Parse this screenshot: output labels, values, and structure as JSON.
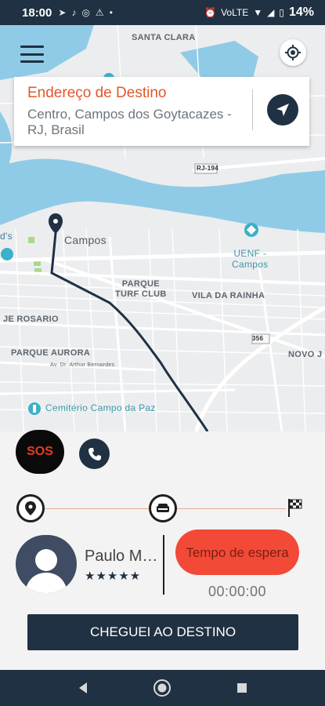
{
  "status_bar": {
    "time": "18:00",
    "battery": "14%",
    "network": "VoLTE"
  },
  "map": {
    "labels": {
      "santa_clara": "SANTA CLARA",
      "rj194": "RJ-194",
      "campos": "Campos",
      "uenf": "UENF -\nCampos",
      "parque_turf": "PARQUE\nTURF CLUB",
      "vila_rainha": "VILA DA RAINHA",
      "rosario": "JE ROSARIO",
      "parque_aurora": "PARQUE AURORA",
      "av_arthur": "Av. Dr. Arthur Bernardes",
      "road_356": "356",
      "novo_j": "NOVO J",
      "cemiterio": "Cemitério Campo da Paz",
      "ds": "d's"
    }
  },
  "destination": {
    "title": "Endereço de Destino",
    "address": "Centro, Campos dos Goytacazes - RJ, Brasil"
  },
  "actions": {
    "sos_label": "SOS"
  },
  "driver": {
    "name": "Paulo Ma...",
    "rating": "★★★★★"
  },
  "wait": {
    "label": "Tempo de espera",
    "timer": "00:00:00"
  },
  "arrive_button": "CHEGUEI AO DESTINO",
  "colors": {
    "navy": "#1f3142",
    "orange": "#e2572a",
    "red_button": "#f24a36",
    "map_water": "#7cbfe0",
    "route": "#1f3142"
  },
  "icons": {
    "menu": "menu-icon",
    "locate": "crosshair-icon",
    "navigate": "navigation-arrow-icon",
    "phone": "phone-icon",
    "pickup": "map-pin-icon",
    "car": "car-icon",
    "finish": "checkered-flag-icon"
  }
}
